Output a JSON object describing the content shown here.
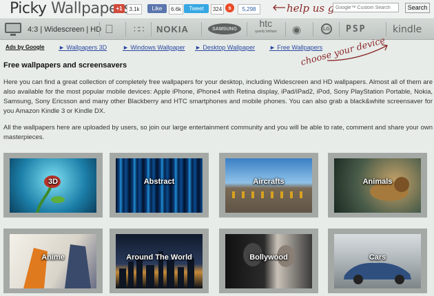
{
  "header": {
    "logo_part1": "Picky",
    "logo_part2": " Wallpapers",
    "gplus_label": "+1",
    "gplus_count": "3.1k",
    "like_label": "Like",
    "like_count": "6.6k",
    "tweet_label": "Tweet",
    "tweet_count": "324",
    "stumble_count": "5,298",
    "help_text": "help us grow",
    "search_placeholder": "Google™ Custom Search",
    "search_button": "Search"
  },
  "devices": {
    "resolution_label": "4:3 | Widescreen | HD",
    "nokia": "NOKIA",
    "samsung": "SAMSUNG",
    "htc": "htc",
    "htc_tagline": "quietly brilliant",
    "lg": "LG",
    "psp": "PSP",
    "kindle": "kindle",
    "icons": [
      "monitor-icon",
      "apple-icon",
      "blackberry-icon",
      "sony-ericsson-icon"
    ]
  },
  "links": {
    "ads_label": "Ads by Google",
    "items": [
      "► Wallpapers 3D",
      "► Windows Wallpaper",
      "► Desktop Wallpaper",
      "► Free Wallpapers"
    ]
  },
  "choose_device": "choose your device",
  "main": {
    "title": "Free wallpapers and screensavers",
    "intro": "Here you can find a great collection of completely free wallpapers for your desktop, including Widescreen and HD wallpapers. Almost all of them are also available for the most popular mobile devices: Apple iPhone, iPhone4 with Retina display, iPad/iPad2, iPod, Sony PlayStation Portable, Nokia, Samsung, Sony Ericsson and many other Blackberry and HTC smartphones and mobile phones. You can also grab a black&white screensaver for you Amazon Kindle 3 or Kindle DX.",
    "intro2": "All the wallpapers here are uploaded by users, so join our large entertainment community and you will be able to rate, comment and share your own masterpieces."
  },
  "categories": [
    {
      "label": "3D"
    },
    {
      "label": "Abstract"
    },
    {
      "label": "Aircrafts"
    },
    {
      "label": "Animals"
    },
    {
      "label": "Anime"
    },
    {
      "label": "Around The World"
    },
    {
      "label": "Bollywood"
    },
    {
      "label": "Cars"
    }
  ]
}
